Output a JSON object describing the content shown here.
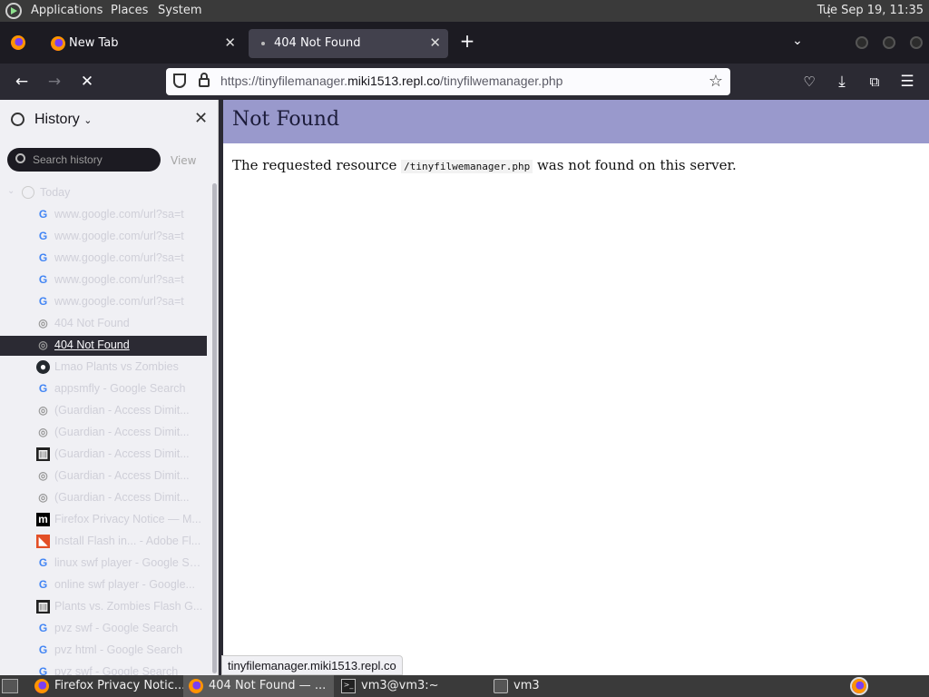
{
  "top_panel": {
    "menu": [
      "Applications",
      "Places",
      "System"
    ],
    "clock": "Tue Sep 19, 11:35"
  },
  "tabs": [
    {
      "label": "New Tab",
      "active": false
    },
    {
      "label": "404 Not Found",
      "active": true
    }
  ],
  "nav": {
    "url_domain_pre": "https://tinyfilemanager.",
    "url_domain": "miki1513.repl.co",
    "url_path": "/tinyfilwemanager.php"
  },
  "sidebar": {
    "title": "History",
    "search_placeholder": "Search history",
    "view_label": "View",
    "group": "Today",
    "items": [
      {
        "favicon": "google",
        "text": "www.google.com/url?sa=t"
      },
      {
        "favicon": "google",
        "text": "www.google.com/url?sa=t"
      },
      {
        "favicon": "google",
        "text": "www.google.com/url?sa=t"
      },
      {
        "favicon": "google",
        "text": "www.google.com/url?sa=t"
      },
      {
        "favicon": "google",
        "text": "www.google.com/url?sa=t"
      },
      {
        "favicon": "globe",
        "text": "404 Not Found"
      },
      {
        "favicon": "globe",
        "text": "404 Not Found",
        "selected": true
      },
      {
        "favicon": "github",
        "text": "Lmao Plants vs Zombies"
      },
      {
        "favicon": "google",
        "text": "appsmfly - Google Search"
      },
      {
        "favicon": "globe",
        "text": "(Guardian - Access Dimit..."
      },
      {
        "favicon": "globe",
        "text": "(Guardian - Access Dimit..."
      },
      {
        "favicon": "archive",
        "text": "(Guardian - Access Dimit..."
      },
      {
        "favicon": "globe",
        "text": "(Guardian - Access Dimit..."
      },
      {
        "favicon": "globe",
        "text": "(Guardian - Access Dimit..."
      },
      {
        "favicon": "mozilla",
        "text": "Firefox Privacy Notice — M..."
      },
      {
        "favicon": "adobe",
        "text": "Install Flash in... - Adobe Fl..."
      },
      {
        "favicon": "google",
        "text": "linux swf player - Google Se..."
      },
      {
        "favicon": "google",
        "text": "online swf player - Google..."
      },
      {
        "favicon": "archive",
        "text": "Plants vs. Zombies Flash G..."
      },
      {
        "favicon": "google",
        "text": "pvz swf - Google Search"
      },
      {
        "favicon": "google",
        "text": "pvz html - Google Search"
      },
      {
        "favicon": "google",
        "text": "pvz swf - Google Search"
      }
    ]
  },
  "content": {
    "title": "Not Found",
    "msg_pre": "The requested resource ",
    "msg_code": "/tinyfilwemanager.php",
    "msg_post": " was not found on this server."
  },
  "status_tooltip": "tinyfilemanager.miki1513.repl.co",
  "taskbar": [
    {
      "label": "Firefox Privacy Notic...",
      "icon": "firefox"
    },
    {
      "label": "404 Not Found — ...",
      "icon": "firefox",
      "active": true
    },
    {
      "label": "vm3@vm3:~",
      "icon": "terminal"
    },
    {
      "label": "vm3",
      "icon": "folder"
    }
  ]
}
